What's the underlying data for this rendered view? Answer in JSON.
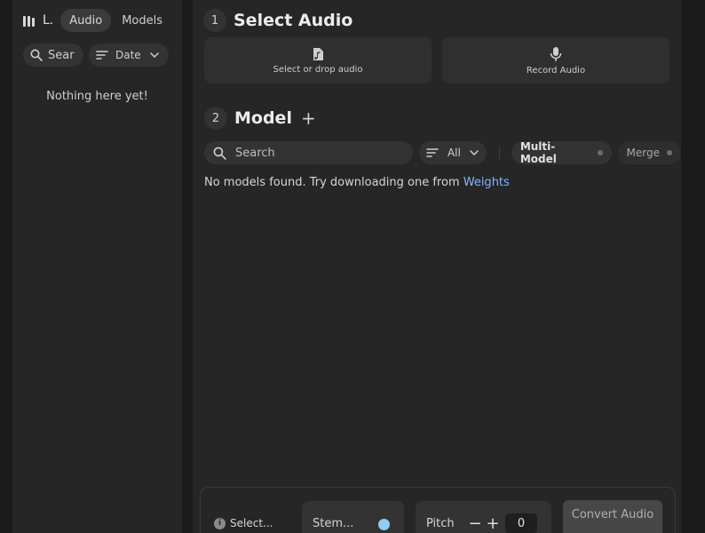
{
  "library": {
    "label": "L.",
    "tabs": [
      {
        "label": "Audio",
        "active": true
      },
      {
        "label": "Models",
        "active": false
      }
    ],
    "search_placeholder": "Sear",
    "sort_label": "Date",
    "empty_message": "Nothing here yet!"
  },
  "select_audio": {
    "step": "1",
    "title": "Select Audio",
    "drop_label": "Select or drop audio",
    "record_label": "Record Audio"
  },
  "model": {
    "step": "2",
    "title": "Model",
    "add_symbol": "+",
    "search_placeholder": "Search",
    "filter_label": "All",
    "toggles": [
      {
        "label": "Multi-Model"
      },
      {
        "label": "Merge"
      }
    ],
    "empty_prefix": "No models found. Try downloading one from ",
    "empty_link": "Weights"
  },
  "bottom_bar": {
    "info_label": "Select...",
    "stem_label": "Stem...",
    "pitch_label": "Pitch",
    "pitch_value": "0",
    "convert_label": "Convert Audio"
  },
  "colors": {
    "accent_link": "#7fb8ff",
    "toggle_knob": "#8fcdf2",
    "panel": "#262626"
  }
}
